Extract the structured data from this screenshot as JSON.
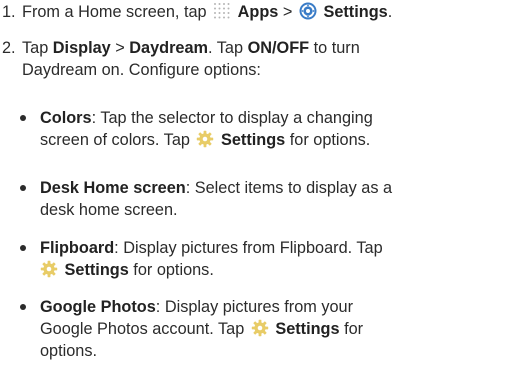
{
  "step1": {
    "number": "1.",
    "lead": "From a Home screen, tap",
    "apps": "Apps",
    "sep": ">",
    "settings": "Settings",
    "end": "."
  },
  "step2": {
    "number": "2.",
    "t1": "Tap",
    "display": "Display",
    "sep": ">",
    "daydream": "Daydream",
    "t2": ". Tap",
    "onoff": "ON/OFF",
    "t3": "to turn",
    "line2": "Daydream on. Configure options:"
  },
  "options": {
    "colors": {
      "title": "Colors",
      "l1": ": Tap the selector to display a changing",
      "l2a": "screen of colors. Tap",
      "settings": "Settings",
      "l2b": "for options."
    },
    "desk": {
      "title": "Desk Home screen",
      "l1": ": Select items to display as a",
      "l2": "desk home screen."
    },
    "flipboard": {
      "title": "Flipboard",
      "l1": ": Display pictures from Flipboard. Tap",
      "settings": "Settings",
      "l2": "for options."
    },
    "photos": {
      "title": "Google Photos",
      "l1": ": Display pictures from your",
      "l2a": "Google Photos account. Tap",
      "settings": "Settings",
      "l2b": "for",
      "l3": "options."
    }
  },
  "icons": {
    "apps": "apps-grid-icon",
    "settings_blue": "settings-app-icon",
    "settings_gear": "gear-icon",
    "gear_color": "#e8cc67",
    "apps_color": "#b5b5b5",
    "settings_app_color": "#3a7cc7"
  }
}
